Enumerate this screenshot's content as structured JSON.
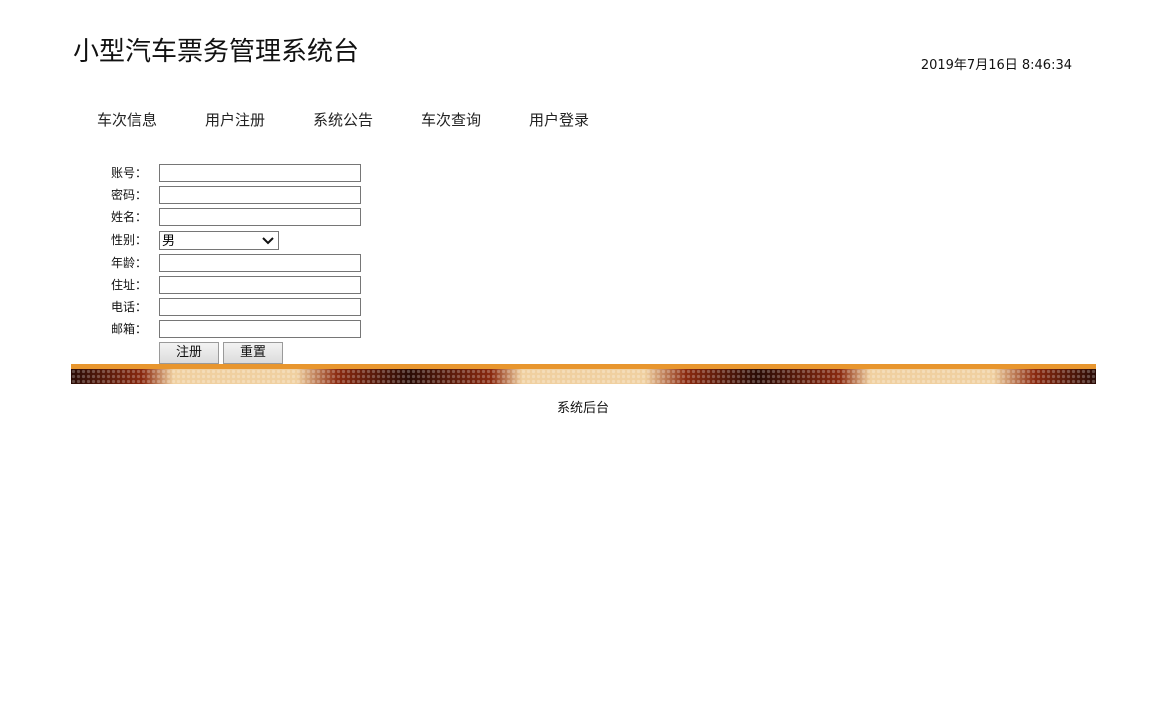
{
  "header": {
    "title": "小型汽车票务管理系统台",
    "datetime": "2019年7月16日 8:46:34"
  },
  "nav": {
    "items": [
      {
        "label": "车次信息"
      },
      {
        "label": "用户注册"
      },
      {
        "label": "系统公告"
      },
      {
        "label": "车次查询"
      },
      {
        "label": "用户登录"
      }
    ]
  },
  "form": {
    "account_label": "账号：",
    "password_label": "密码：",
    "name_label": "姓名：",
    "gender_label": "性别：",
    "gender_value": "男",
    "age_label": "年龄：",
    "address_label": "住址：",
    "phone_label": "电话：",
    "email_label": "邮箱：",
    "submit_label": "注册",
    "reset_label": "重置"
  },
  "banner": {
    "colors": [
      "#e8962e",
      "#3a1208",
      "#8a2a10",
      "#f0d0a0"
    ]
  },
  "footer": {
    "text": "系统后台"
  }
}
